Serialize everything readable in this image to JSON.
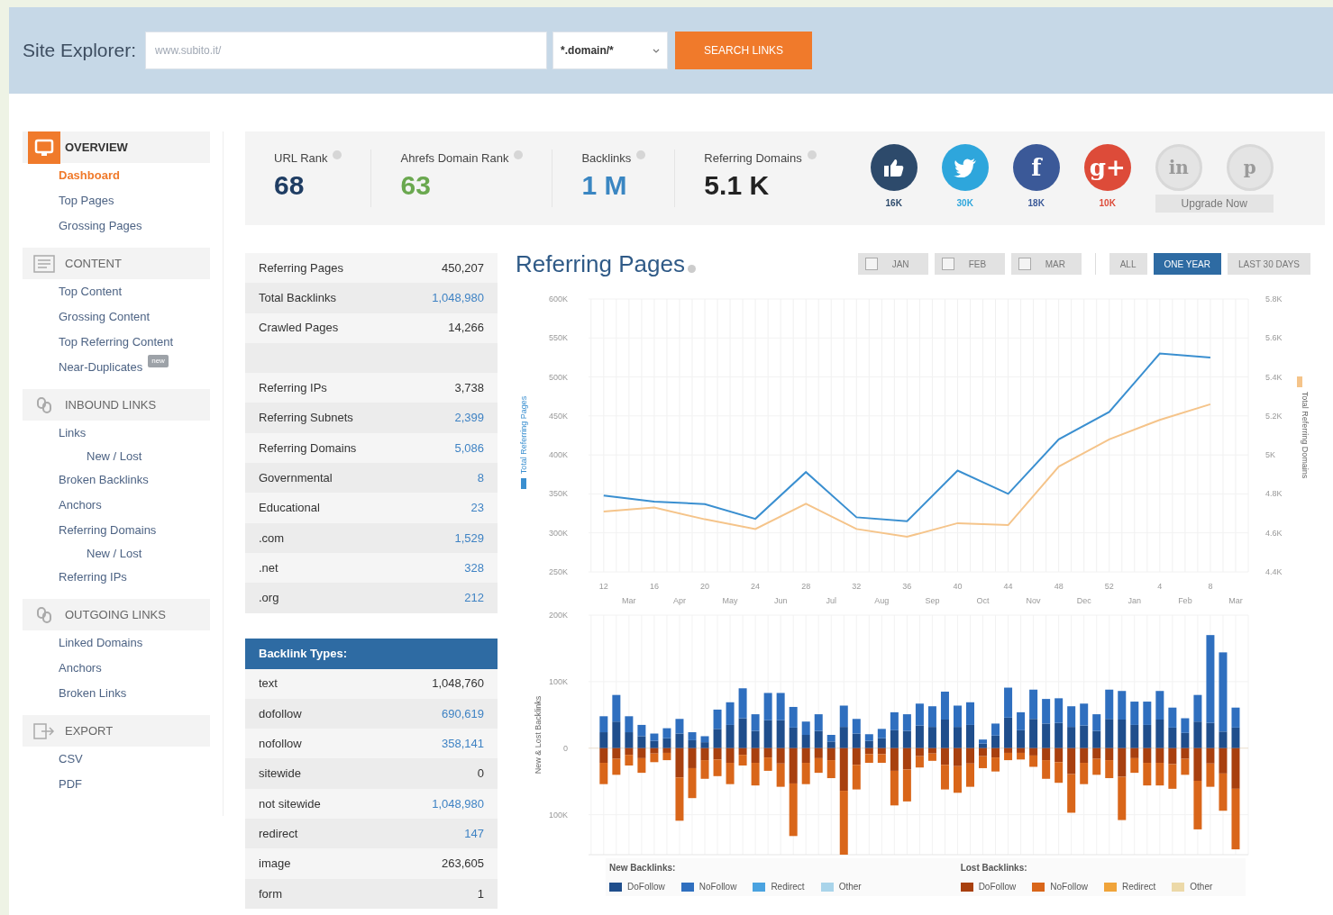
{
  "header": {
    "label": "Site Explorer:",
    "url_field": {
      "placeholder": "www.subito.it/"
    },
    "mode_select": {
      "value": "*.domain/*"
    },
    "search_button": "SEARCH LINKS"
  },
  "sidebar": {
    "sections": [
      {
        "title": "OVERVIEW",
        "kind": "overview",
        "active": true,
        "items": [
          {
            "label": "Dashboard",
            "selected": true
          },
          {
            "label": "Top Pages",
            "selected": false
          },
          {
            "label": "Grossing Pages",
            "selected": false
          }
        ]
      },
      {
        "title": "CONTENT",
        "kind": "content",
        "active": false,
        "items": [
          {
            "label": "Top Content",
            "selected": false
          },
          {
            "label": "Grossing Content",
            "selected": false
          },
          {
            "label": "Top Referring Content",
            "selected": false
          },
          {
            "label": "Near-Duplicates",
            "selected": false,
            "badge": "new"
          }
        ]
      },
      {
        "title": "INBOUND LINKS",
        "kind": "inbound",
        "active": false,
        "items": [
          {
            "label": "Links",
            "selected": false,
            "children": [
              {
                "label": "New / Lost",
                "selected": false
              }
            ]
          },
          {
            "label": "Broken Backlinks",
            "selected": false
          },
          {
            "label": "Anchors",
            "selected": false
          },
          {
            "label": "Referring Domains",
            "selected": false,
            "children": [
              {
                "label": "New / Lost",
                "selected": false
              }
            ]
          },
          {
            "label": "Referring IPs",
            "selected": false
          }
        ]
      },
      {
        "title": "OUTGOING LINKS",
        "kind": "outgoing",
        "active": false,
        "items": [
          {
            "label": "Linked Domains",
            "selected": false
          },
          {
            "label": "Anchors",
            "selected": false
          },
          {
            "label": "Broken Links",
            "selected": false
          }
        ]
      },
      {
        "title": "EXPORT",
        "kind": "export",
        "active": false,
        "items": [
          {
            "label": "CSV",
            "selected": false
          },
          {
            "label": "PDF",
            "selected": false
          }
        ]
      }
    ]
  },
  "stats": [
    {
      "label": "URL Rank",
      "value": "68",
      "color": "#1f3d63"
    },
    {
      "label": "Ahrefs Domain Rank",
      "value": "63",
      "color": "#6aa84f"
    },
    {
      "label": "Backlinks",
      "value": "1 M",
      "color": "#3a86c2"
    },
    {
      "label": "Referring Domains",
      "value": "5.1 K",
      "color": "#222222"
    }
  ],
  "socials": [
    {
      "kind": "thumb",
      "count": "16K",
      "color": "#2d4a6b",
      "disabled": false
    },
    {
      "kind": "bird",
      "count": "30K",
      "color": "#2ea6dc",
      "disabled": false
    },
    {
      "kind": "glyph",
      "glyph": "f",
      "count": "18K",
      "color": "#3b5998",
      "disabled": false
    },
    {
      "kind": "glyph",
      "glyph": "g+",
      "count": "10K",
      "color": "#dd4b39",
      "disabled": false
    },
    {
      "kind": "glyph",
      "glyph": "in",
      "color": "#e4e4e4",
      "disabled": true
    },
    {
      "kind": "glyph",
      "glyph": "p",
      "color": "#e4e4e4",
      "disabled": true
    }
  ],
  "upgrade_button": "Upgrade Now",
  "summary_table": {
    "rows": [
      {
        "kind": "row",
        "label": "Referring Pages",
        "value": "450,207",
        "link": false
      },
      {
        "kind": "row",
        "label": "Total Backlinks",
        "value": "1,048,980",
        "link": true
      },
      {
        "kind": "row",
        "label": "Crawled Pages",
        "value": "14,266",
        "link": false
      },
      {
        "kind": "spacer"
      },
      {
        "kind": "row",
        "label": "Referring IPs",
        "value": "3,738",
        "link": false
      },
      {
        "kind": "row",
        "label": "Referring Subnets",
        "value": "2,399",
        "link": true
      },
      {
        "kind": "row",
        "label": "Referring Domains",
        "value": "5,086",
        "link": true
      },
      {
        "kind": "row",
        "label": "Governmental",
        "value": "8",
        "link": true
      },
      {
        "kind": "row",
        "label": "Educational",
        "value": "23",
        "link": true
      },
      {
        "kind": "row",
        "label": ".com",
        "value": "1,529",
        "link": true
      },
      {
        "kind": "row",
        "label": ".net",
        "value": "328",
        "link": true
      },
      {
        "kind": "row",
        "label": ".org",
        "value": "212",
        "link": true
      }
    ]
  },
  "backlink_types": {
    "title": "Backlink Types:",
    "rows": [
      {
        "label": "text",
        "value": "1,048,760",
        "link": false
      },
      {
        "label": "dofollow",
        "value": "690,619",
        "link": true
      },
      {
        "label": "nofollow",
        "value": "358,141",
        "link": true
      },
      {
        "label": "sitewide",
        "value": "0",
        "link": false
      },
      {
        "label": "not sitewide",
        "value": "1,048,980",
        "link": true
      },
      {
        "label": "redirect",
        "value": "147",
        "link": true
      },
      {
        "label": "image",
        "value": "263,605",
        "link": false
      },
      {
        "label": "form",
        "value": "1",
        "link": false
      }
    ]
  },
  "chart_panel": {
    "title": "Referring Pages",
    "month_filters": [
      {
        "label": "JAN",
        "checked": false
      },
      {
        "label": "FEB",
        "checked": false
      },
      {
        "label": "MAR",
        "checked": false
      }
    ],
    "ranges": [
      {
        "label": "ALL",
        "selected": false
      },
      {
        "label": "ONE YEAR",
        "selected": true
      },
      {
        "label": "LAST 30 DAYS",
        "selected": false
      }
    ],
    "line_chart": {
      "chart_data": {
        "type": "line",
        "grid": true,
        "categories": [
          "12",
          "16",
          "20",
          "24",
          "28",
          "32",
          "36",
          "40",
          "44",
          "48",
          "52",
          "4",
          "8"
        ],
        "ylim": [
          250,
          600
        ],
        "yticks": [
          {
            "value": 250,
            "label": "250K"
          },
          {
            "value": 300,
            "label": "300K"
          },
          {
            "value": 350,
            "label": "350K"
          },
          {
            "value": 400,
            "label": "400K"
          },
          {
            "value": 450,
            "label": "450K"
          },
          {
            "value": 500,
            "label": "500K"
          },
          {
            "value": 550,
            "label": "550K"
          },
          {
            "value": 600,
            "label": "600K"
          }
        ],
        "y2lim": [
          4400,
          5800
        ],
        "y2ticks": [
          {
            "value": 4400,
            "label": "4.4K"
          },
          {
            "value": 4600,
            "label": "4.6K"
          },
          {
            "value": 4800,
            "label": "4.8K"
          },
          {
            "value": 5000,
            "label": "5K"
          },
          {
            "value": 5200,
            "label": "5.2K"
          },
          {
            "value": 5400,
            "label": "5.4K"
          },
          {
            "value": 5600,
            "label": "5.6K"
          },
          {
            "value": 5800,
            "label": "5.8K"
          }
        ],
        "series": [
          {
            "name": "Total Referring Pages",
            "color": "#3a8fd0",
            "values": [
              348,
              340,
              337,
              318,
              378,
              320,
              315,
              380,
              350,
              420,
              455,
              530,
              525
            ]
          },
          {
            "name": "Total Referring Domains",
            "color": "#f5c48a",
            "axis": "y2",
            "values": [
              4710,
              4730,
              4670,
              4620,
              4750,
              4620,
              4580,
              4650,
              4640,
              4940,
              5080,
              5180,
              5260
            ]
          }
        ]
      },
      "month_labels": [
        "Mar",
        "Apr",
        "May",
        "Jun",
        "Jul",
        "Aug",
        "Sep",
        "Oct",
        "Nov",
        "Dec",
        "Jan",
        "Feb",
        "Mar"
      ]
    },
    "bar_chart": {
      "chart_data": {
        "type": "bar",
        "stacked": true,
        "grid": true,
        "categories": [
          null,
          null,
          null,
          null,
          null,
          null,
          null,
          null,
          null,
          null,
          null,
          null,
          null,
          null,
          null,
          null,
          null,
          null,
          null,
          null,
          null,
          null,
          null,
          null,
          null,
          null,
          null,
          null,
          null,
          null,
          null,
          null,
          null,
          null,
          null,
          null,
          null,
          null,
          null,
          null,
          null,
          null,
          null,
          null,
          null,
          null,
          null,
          null,
          null,
          null,
          null
        ],
        "ylim": [
          -160,
          200
        ],
        "yticks": [
          {
            "value": 0,
            "label": "0"
          },
          {
            "value": 100,
            "label": "100K"
          },
          {
            "value": 200,
            "label": "200K"
          }
        ],
        "series": [
          {
            "name": "DoFollow",
            "color": "#1f4e8c",
            "values": [
              24,
              40,
              24,
              18,
              11,
              15,
              22,
              12,
              9,
              29,
              35,
              45,
              26,
              42,
              42,
              31,
              20,
              26,
              10,
              32,
              22,
              11,
              15,
              27,
              26,
              34,
              32,
              43,
              32,
              35,
              7,
              19,
              46,
              27,
              44,
              37,
              38,
              32,
              34,
              26,
              44,
              43,
              35,
              35,
              43,
              31,
              23,
              40,
              38,
              25,
              31
            ]
          },
          {
            "name": "NoFollow",
            "color": "#2f6fbf",
            "values": [
              24,
              40,
              24,
              17,
              11,
              15,
              22,
              12,
              9,
              29,
              34,
              45,
              25,
              41,
              41,
              31,
              20,
              25,
              10,
              32,
              22,
              10,
              14,
              27,
              25,
              33,
              31,
              42,
              32,
              34,
              6,
              18,
              45,
              27,
              44,
              37,
              37,
              31,
              33,
              25,
              44,
              43,
              35,
              35,
              43,
              30,
              22,
              40,
              132,
              119,
              30
            ]
          },
          {
            "name": "DoFollow",
            "color": "#a8400f",
            "values": [
              -22,
              -16,
              -10,
              -15,
              -8,
              -7,
              -44,
              -30,
              -18,
              -17,
              -22,
              -10,
              -22,
              -14,
              -23,
              -53,
              -22,
              -15,
              -18,
              -64,
              -25,
              -9,
              -9,
              -34,
              -32,
              -12,
              -8,
              -25,
              -27,
              -23,
              -12,
              -14,
              -7,
              -7,
              -11,
              -18,
              -21,
              -39,
              -22,
              -16,
              -18,
              -43,
              -15,
              -22,
              -22,
              -24,
              -16,
              -49,
              -23,
              -38,
              -61
            ]
          },
          {
            "name": "NoFollow",
            "color": "#d9661a",
            "values": [
              -32,
              -24,
              -16,
              -22,
              -13,
              -11,
              -65,
              -45,
              -28,
              -25,
              -32,
              -16,
              -34,
              -20,
              -35,
              -79,
              -32,
              -22,
              -27,
              -96,
              -37,
              -13,
              -13,
              -52,
              -48,
              -17,
              -11,
              -37,
              -40,
              -35,
              -18,
              -21,
              -11,
              -10,
              -17,
              -28,
              -31,
              -58,
              -32,
              -24,
              -27,
              -65,
              -22,
              -34,
              -34,
              -37,
              -24,
              -73,
              -35,
              -56,
              -91
            ]
          }
        ]
      },
      "ylabel": "New & Lost Backlinks",
      "lower_tick_label": "100K",
      "legend": [
        {
          "title": "New Backlinks:",
          "items": [
            {
              "label": "Redirect",
              "color": "#4aa3e0"
            },
            {
              "label": "Other",
              "color": "#a9d4ea"
            }
          ]
        },
        {
          "title": "Lost Backlinks:",
          "items": [
            {
              "label": "Redirect",
              "color": "#f0a43a"
            },
            {
              "label": "Other",
              "color": "#ecd9a8"
            }
          ]
        }
      ]
    }
  }
}
